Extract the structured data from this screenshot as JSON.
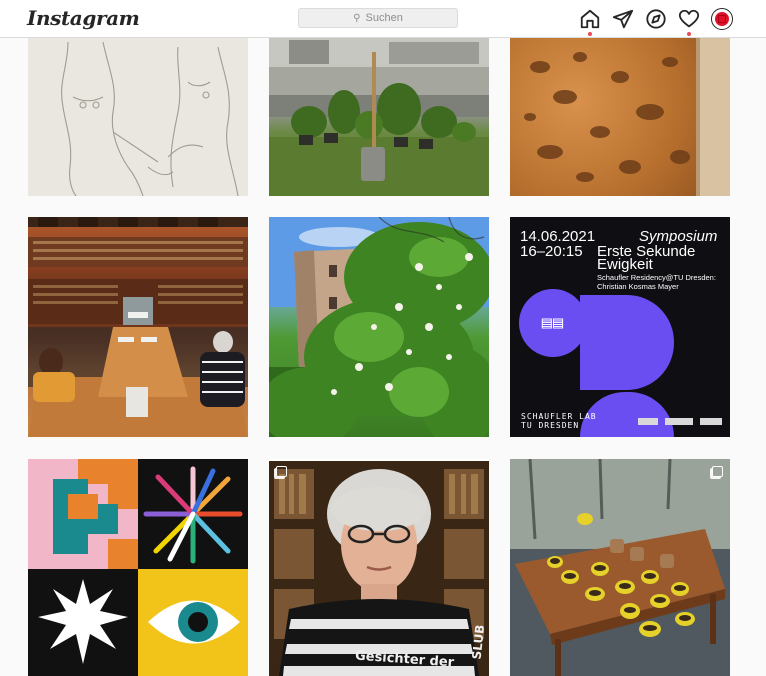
{
  "app": {
    "logo_text": "Instagram"
  },
  "search": {
    "placeholder": "Suchen",
    "icon": "search-icon"
  },
  "nav_icons": [
    "home-icon",
    "direct-message-icon",
    "explore-icon",
    "activity-heart-icon",
    "profile-avatar-icon"
  ],
  "colors": {
    "notification_dot": "#ed4956",
    "avatar_red": "#e0102a",
    "accent_purple": "#6b4ef2"
  },
  "posts": [
    {
      "id": "sketch",
      "description_name": "sketch-figures-post"
    },
    {
      "id": "garden",
      "description_name": "garden-plants-post"
    },
    {
      "id": "stone",
      "description_name": "porous-stone-post"
    },
    {
      "id": "library",
      "description_name": "library-reading-room-post"
    },
    {
      "id": "building",
      "description_name": "building-blossoms-post"
    },
    {
      "id": "symposium",
      "description_name": "symposium-poster-post",
      "date": "14.06.2021",
      "time": "16–20:15",
      "label": "Symposium",
      "headline_1": "Erste Sekunde",
      "headline_2": "Ewigkeit",
      "sub_1": "Schaufler Residency@TU Dresden:",
      "sub_2": "Christian Kosmas Mayer",
      "footer_1": "SCHAUFLER LAB",
      "footer_2": "TU DRESDEN"
    },
    {
      "id": "graphic",
      "description_name": "colorful-graphic-post"
    },
    {
      "id": "portrait",
      "description_name": "portrait-woman-post",
      "shirt_text_1": "Gesichter der",
      "shirt_text_2": "SLUB"
    },
    {
      "id": "table",
      "description_name": "plants-on-table-post"
    }
  ]
}
